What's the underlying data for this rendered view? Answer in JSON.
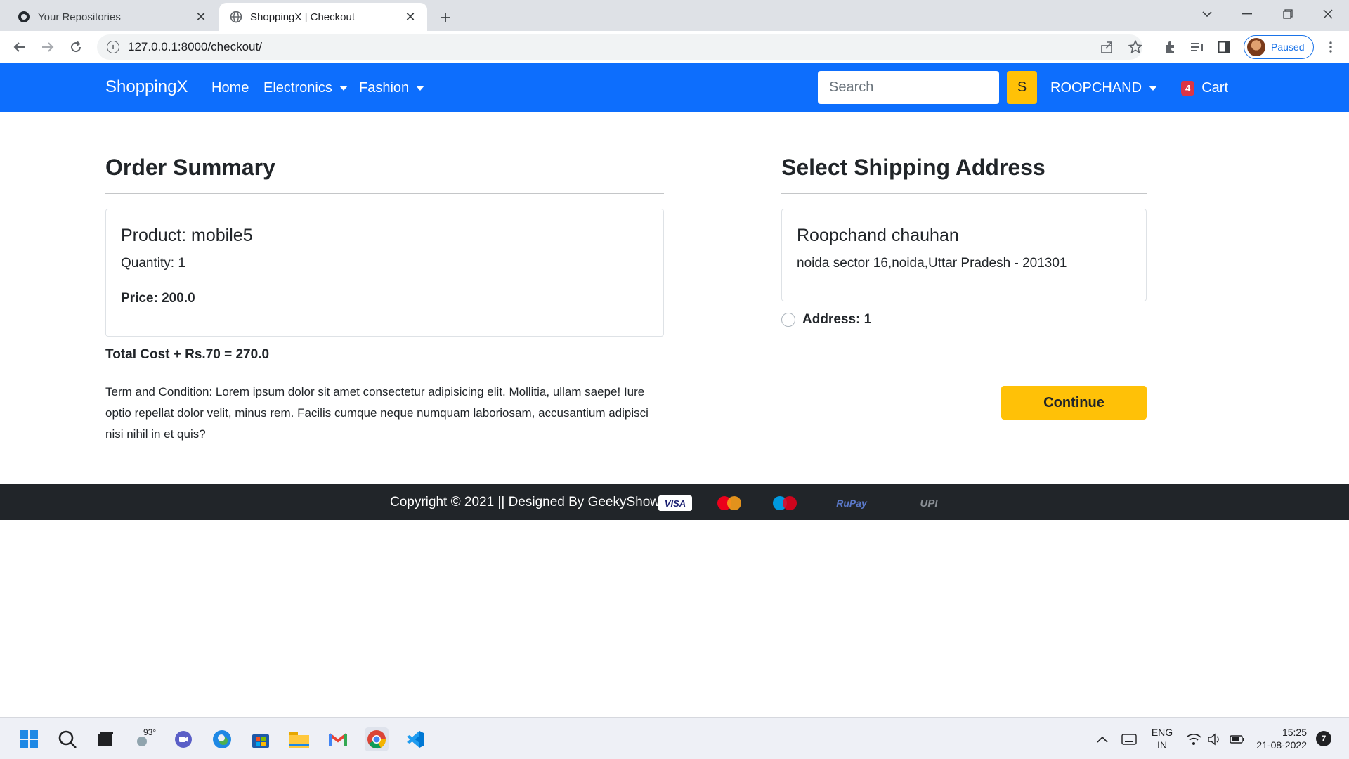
{
  "browser": {
    "tabs": [
      {
        "title": "Your Repositories",
        "active": false
      },
      {
        "title": "ShoppingX | Checkout",
        "active": true
      }
    ],
    "url": "127.0.0.1:8000/checkout/",
    "profile_status": "Paused"
  },
  "navbar": {
    "brand": "ShoppingX",
    "links": [
      "Home",
      "Electronics",
      "Fashion"
    ],
    "search_placeholder": "Search",
    "search_button": "S",
    "user": "ROOPCHAND",
    "cart_count": "4",
    "cart_label": "Cart"
  },
  "order_summary": {
    "heading": "Order Summary",
    "product": "Product: mobile5",
    "quantity": "Quantity: 1",
    "price": "Price: 200.0",
    "total": "Total Cost + Rs.70 = 270.0",
    "terms": "Term and Condition: Lorem ipsum dolor sit amet consectetur adipisicing elit. Mollitia, ullam saepe! Iure optio repellat dolor velit, minus rem. Facilis cumque neque numquam laboriosam, accusantium adipisci nisi nihil in et quis?"
  },
  "shipping": {
    "heading": "Select Shipping Address",
    "name": "Roopchand chauhan",
    "address": "noida sector 16,noida,Uttar Pradesh - 201301",
    "radio_label": "Address: 1",
    "continue_label": "Continue"
  },
  "footer": {
    "text": "Copyright © 2021 || Designed By GeekyShows ||",
    "payments": [
      "VISA",
      "MasterCard",
      "Maestro",
      "RuPay",
      "UPI"
    ]
  },
  "taskbar": {
    "weather": "93°",
    "lang_line1": "ENG",
    "lang_line2": "IN",
    "time": "15:25",
    "date": "21-08-2022",
    "notifications": "7"
  }
}
